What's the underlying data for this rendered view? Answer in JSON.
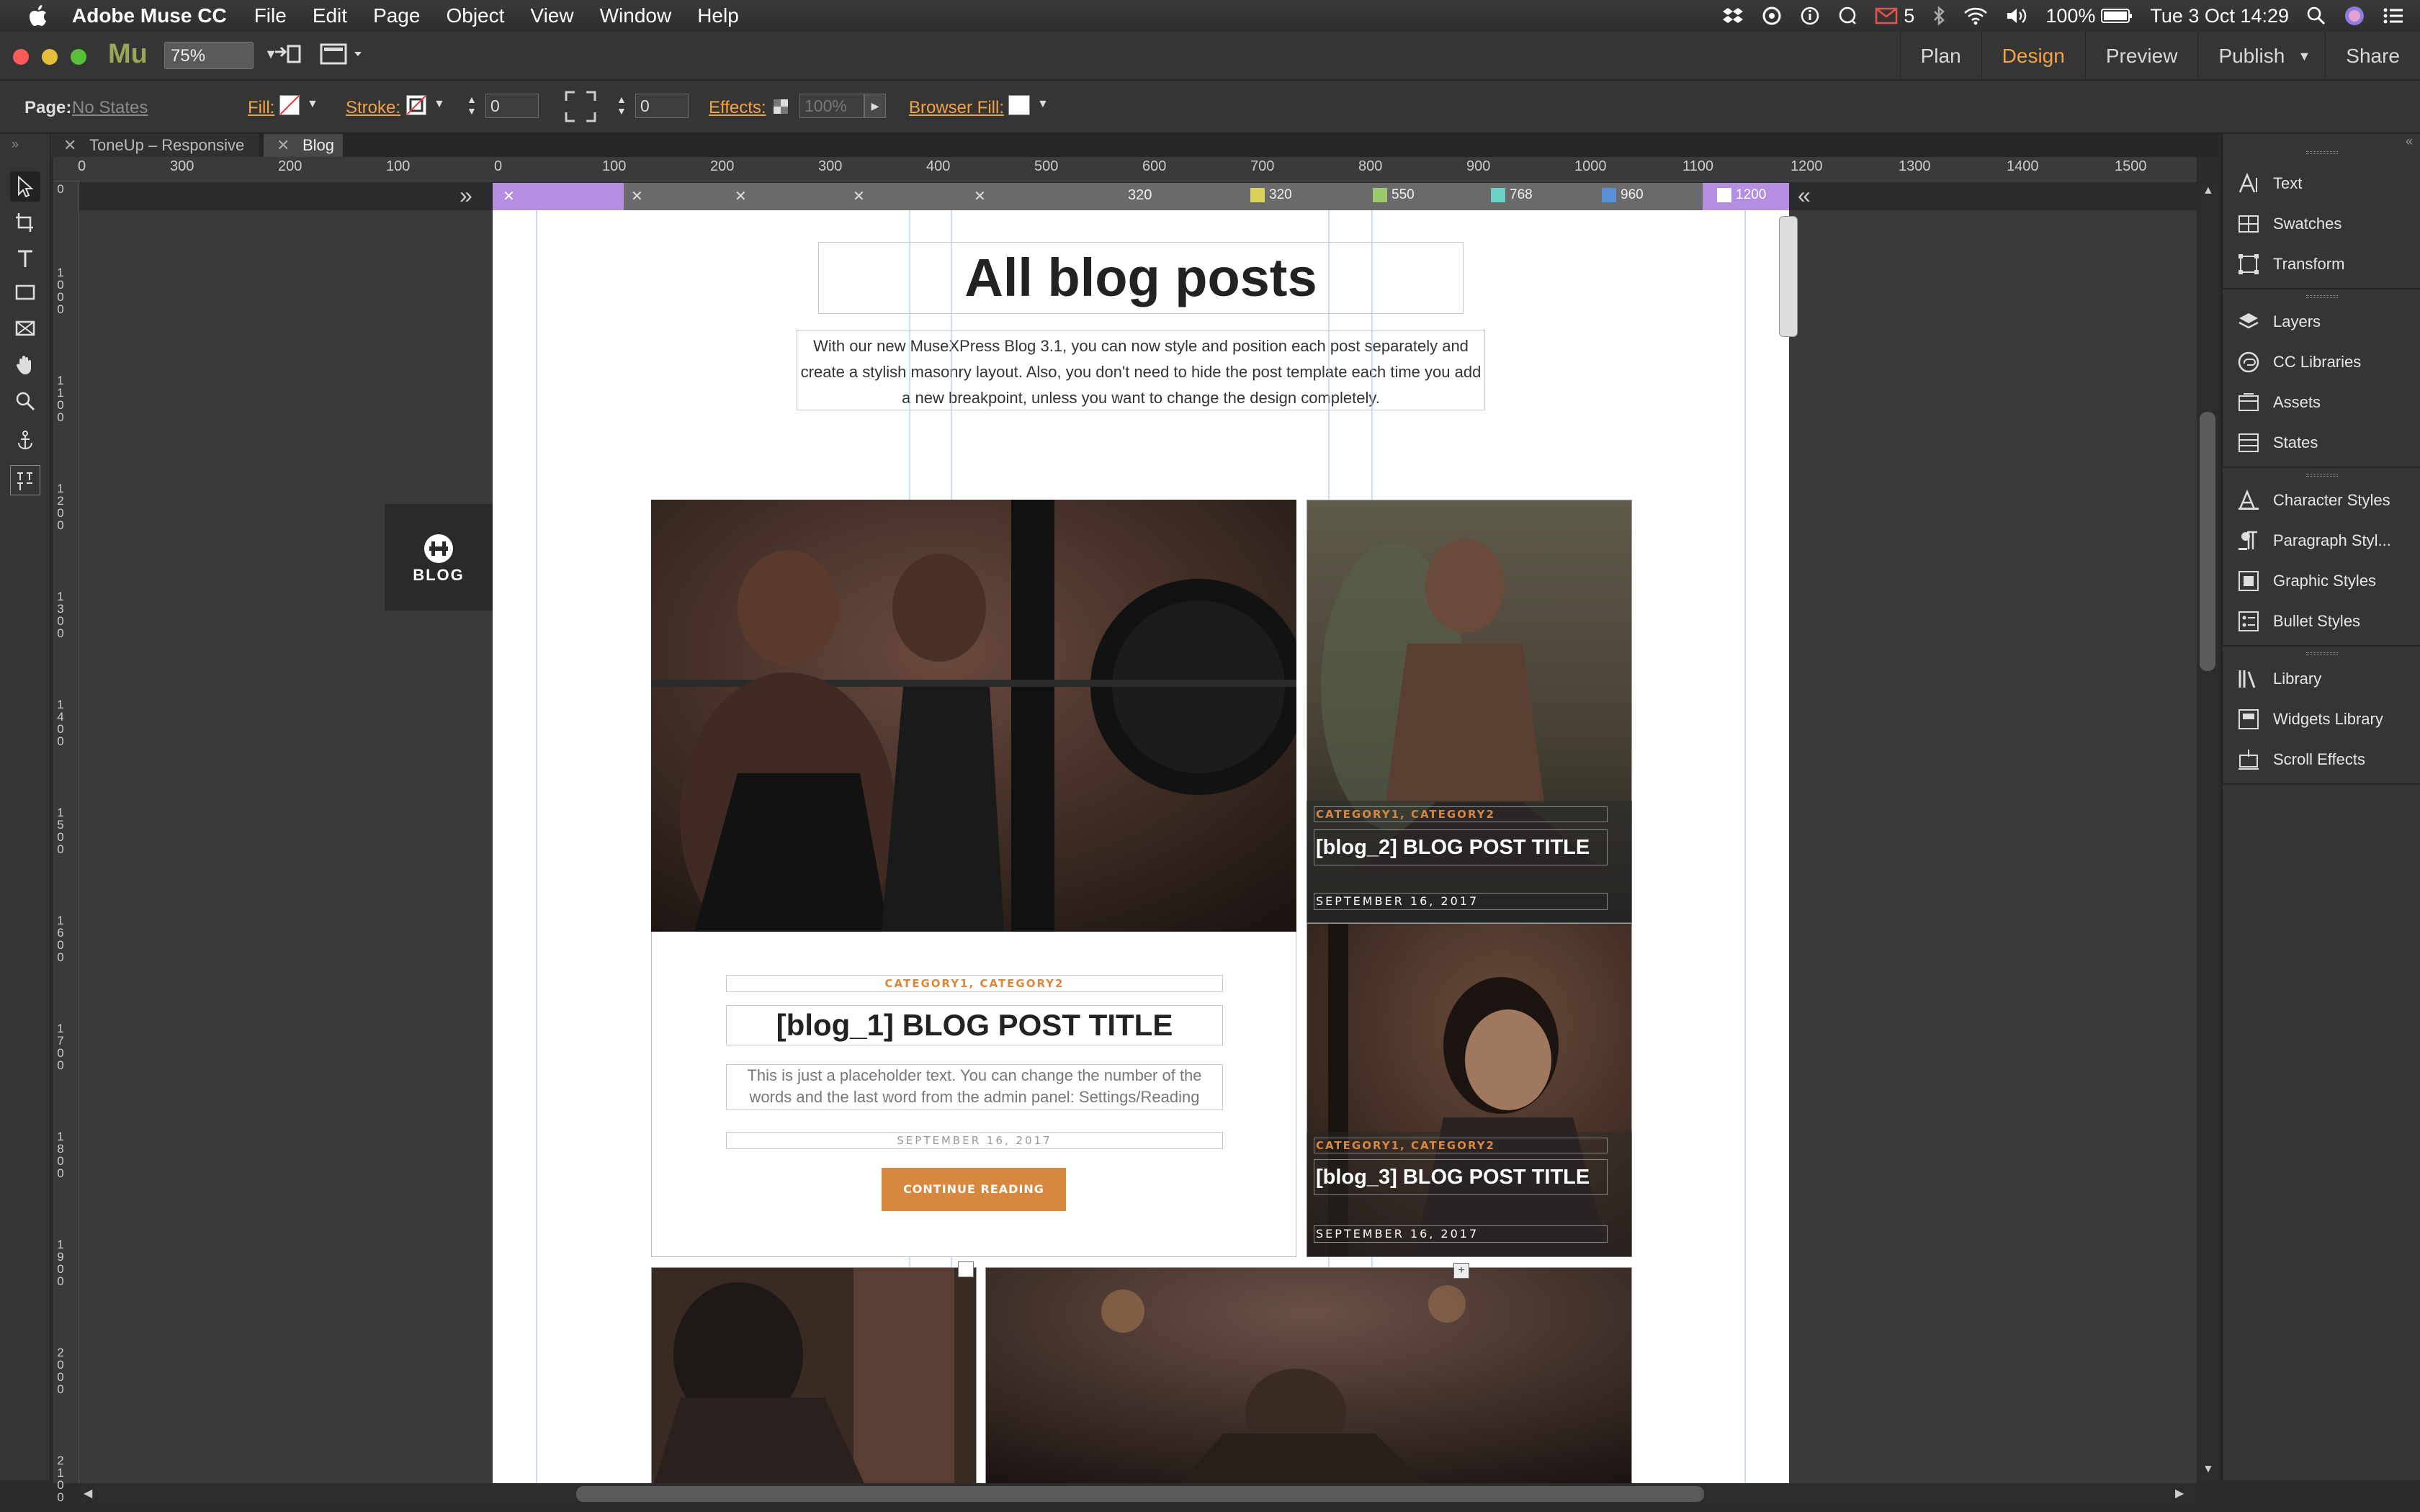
{
  "menubar": {
    "app_name": "Adobe Muse CC",
    "items": [
      "File",
      "Edit",
      "Page",
      "Object",
      "View",
      "Window",
      "Help"
    ],
    "mail_count": "5",
    "battery": "100%",
    "datetime": "Tue 3 Oct  14:29"
  },
  "appbar": {
    "logo": "Mu",
    "zoom": "75%",
    "modes": [
      "Plan",
      "Design",
      "Preview",
      "Publish",
      "Share"
    ],
    "active_mode": "Design"
  },
  "controlbar": {
    "page_label": "Page:",
    "page_state": "No States",
    "fill_label": "Fill:",
    "stroke_label": "Stroke:",
    "stroke_value": "0",
    "corner_value": "0",
    "effects_label": "Effects:",
    "opacity": "100%",
    "browser_fill_label": "Browser Fill:"
  },
  "tabs": [
    {
      "label": "ToneUp – Responsive"
    },
    {
      "label": "Blog"
    }
  ],
  "ruler": {
    "h_ticks": [
      "0",
      "300",
      "200",
      "100",
      "0",
      "100",
      "200",
      "300",
      "400",
      "500",
      "600",
      "700",
      "800",
      "900",
      "1000",
      "1100",
      "1200",
      "1300",
      "1400",
      "1500"
    ],
    "v_ticks": [
      "0",
      "1000",
      "1100",
      "1200",
      "1300",
      "1400",
      "1500",
      "1600",
      "1700",
      "1800",
      "1900",
      "2000",
      "2100"
    ]
  },
  "breakpoints": {
    "current": "320",
    "markers": [
      "320",
      "550",
      "768",
      "960",
      "1200"
    ]
  },
  "page": {
    "heading": "All blog posts",
    "intro": "With our new MuseXPress Blog 3.1, you can now style and position each post separately and create a stylish masonry layout. Also, you don't need to hide the post template each time you add a new breakpoint, unless you want to change the design completely.",
    "blog_badge": "BLOG",
    "post1": {
      "categories": "CATEGORY1, CATEGORY2",
      "title": "[blog_1] BLOG POST TITLE",
      "excerpt": "This is just a placeholder text. You can change the number of the words and the last word from the admin panel: Settings/Reading",
      "date": "SEPTEMBER 16, 2017",
      "button": "CONTINUE READING"
    },
    "post2": {
      "categories": "CATEGORY1, CATEGORY2",
      "title": "[blog_2] BLOG POST TITLE",
      "date": "SEPTEMBER 16, 2017"
    },
    "post3": {
      "categories": "CATEGORY1, CATEGORY2",
      "title": "[blog_3] BLOG POST TITLE",
      "date": "SEPTEMBER 16, 2017"
    }
  },
  "panels": {
    "group1": [
      "Text",
      "Swatches",
      "Transform"
    ],
    "group2": [
      "Layers",
      "CC Libraries",
      "Assets",
      "States"
    ],
    "group3": [
      "Character Styles",
      "Paragraph Styl...",
      "Graphic Styles",
      "Bullet Styles"
    ],
    "group4": [
      "Library",
      "Widgets Library",
      "Scroll Effects"
    ]
  },
  "colors": {
    "accent": "#f0a44a",
    "breakpoint": "#b48ee0",
    "button": "#d8873f"
  }
}
